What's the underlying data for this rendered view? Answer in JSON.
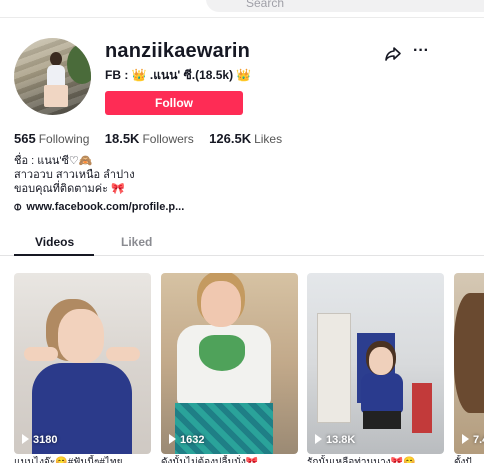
{
  "search": {
    "placeholder": "Search"
  },
  "profile": {
    "username": "nanziikaewarin",
    "subtitle": "FB : 👑 .แนน' ซี.(18.5k) 👑",
    "follow_label": "Follow"
  },
  "stats": {
    "following_count": "565",
    "following_label": "Following",
    "followers_count": "18.5K",
    "followers_label": "Followers",
    "likes_count": "126.5K",
    "likes_label": "Likes"
  },
  "bio": {
    "line1": "ชื่อ : แนน'ซี♡🙈",
    "line2": "สาวอวบ สาวเหนือ ลำปาง",
    "line3": "ขอบคุณที่ติดตามค่ะ 🎀"
  },
  "link": {
    "text": "www.facebook.com/profile.p..."
  },
  "tabs": [
    {
      "label": "Videos",
      "active": true
    },
    {
      "label": "Liked",
      "active": false
    }
  ],
  "videos": [
    {
      "views": "3180",
      "caption": "แนนไงจ๊ะ😊#ฟันนี้ๆ#ไทย"
    },
    {
      "views": "1632",
      "caption": "ดังนั้นไม่ต้องปลื้มนั่ง🎀"
    },
    {
      "views": "13.8K",
      "caption": "รักนั้นเหลือท่านนาง🎀😊"
    },
    {
      "views": "7.4",
      "caption": "ตั้งปั"
    }
  ],
  "icons": {
    "share": "share-icon",
    "more": "more-icon",
    "link": "link-icon",
    "play": "play-icon"
  },
  "colors": {
    "follow_button": "#fe2c55",
    "text": "#161823",
    "muted": "#8a8b91"
  }
}
